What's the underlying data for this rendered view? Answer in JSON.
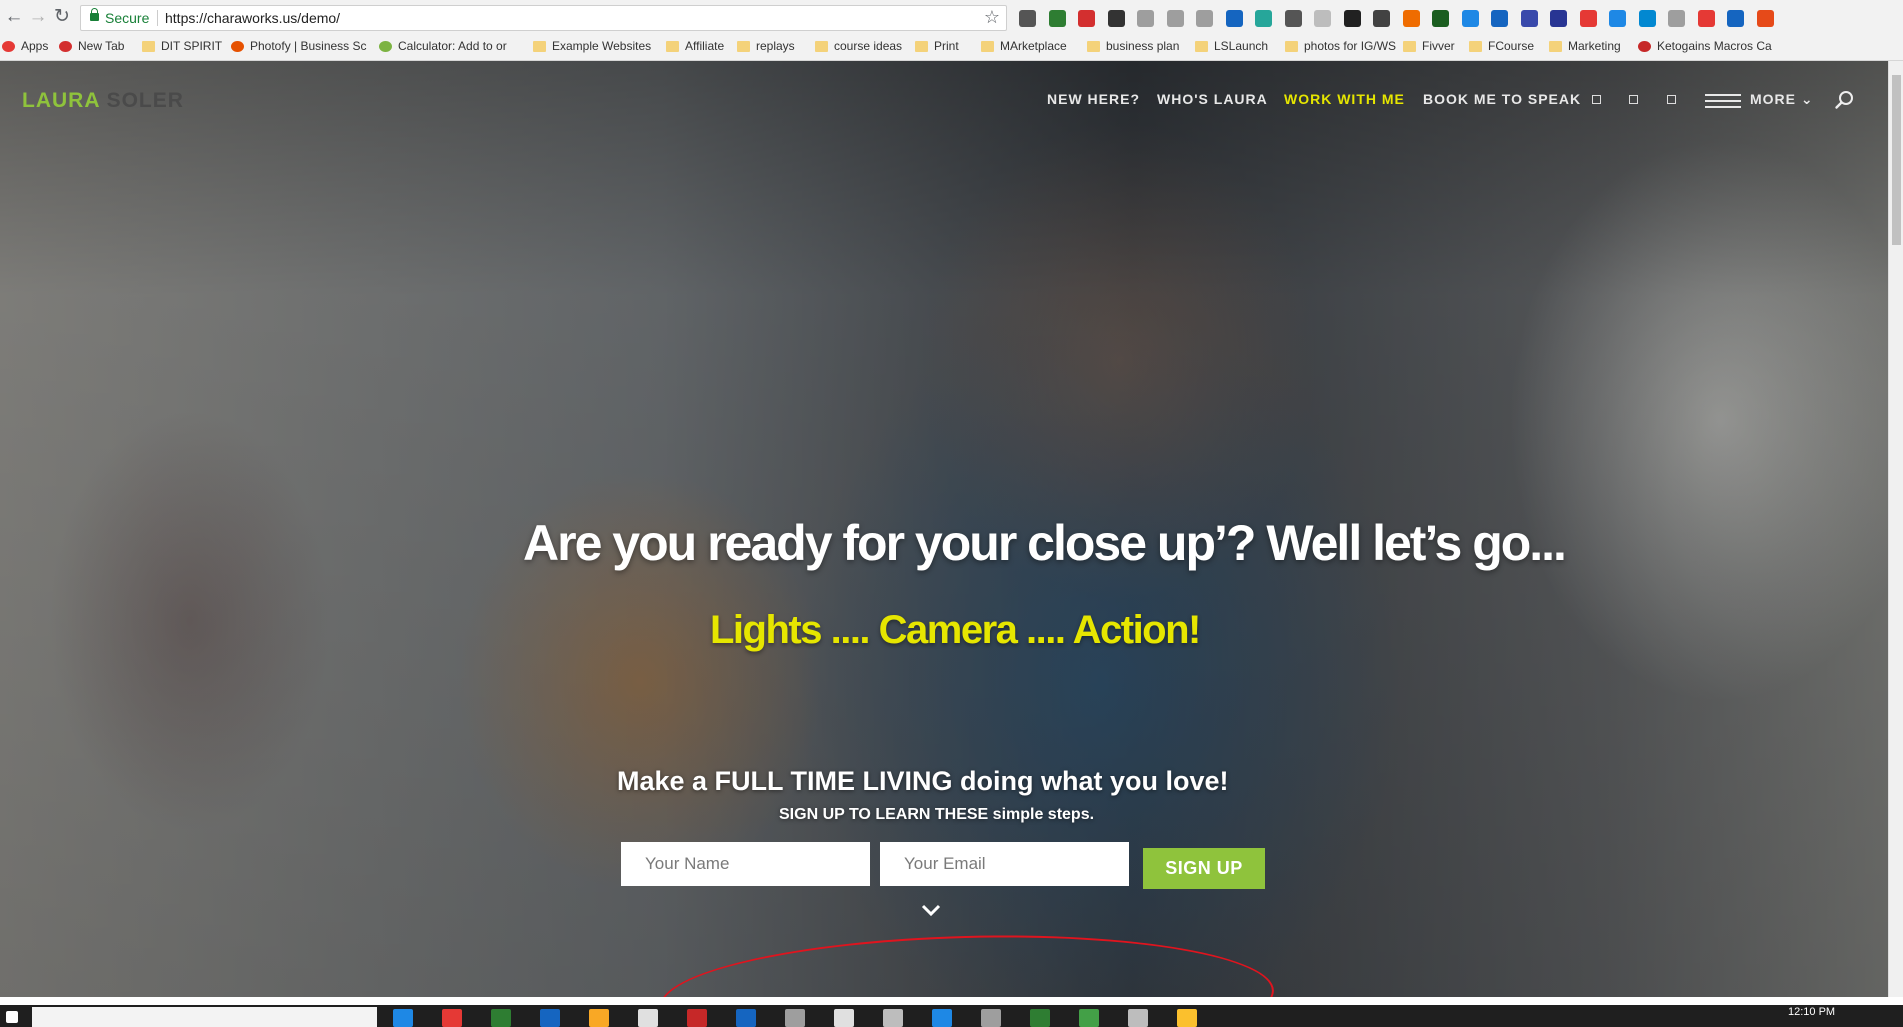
{
  "browser": {
    "secure_label": "Secure",
    "url": "https://charaworks.us/demo/",
    "bookmarks": [
      {
        "label": "Apps",
        "icon": "apps-grid-icon",
        "color": "#e53935"
      },
      {
        "label": "New Tab",
        "icon": "new-tab-icon",
        "color": "#d32f2f"
      },
      {
        "label": "DIT SPIRIT",
        "icon": "folder-icon",
        "color": "#f4d27a"
      },
      {
        "label": "Photofy | Business Sc",
        "icon": "photofy-icon",
        "color": "#e65100"
      },
      {
        "label": "Calculator: Add to or",
        "icon": "calculator-icon",
        "color": "#7cb342"
      },
      {
        "label": "Example Websites",
        "icon": "folder-icon",
        "color": "#f4d27a"
      },
      {
        "label": "Affiliate",
        "icon": "folder-icon",
        "color": "#f4d27a"
      },
      {
        "label": "replays",
        "icon": "folder-icon",
        "color": "#f4d27a"
      },
      {
        "label": "course ideas",
        "icon": "folder-icon",
        "color": "#f4d27a"
      },
      {
        "label": "Print",
        "icon": "folder-icon",
        "color": "#f4d27a"
      },
      {
        "label": "MArketplace",
        "icon": "folder-icon",
        "color": "#f4d27a"
      },
      {
        "label": "business plan",
        "icon": "folder-icon",
        "color": "#f4d27a"
      },
      {
        "label": "LSLaunch",
        "icon": "folder-icon",
        "color": "#f4d27a"
      },
      {
        "label": "photos for IG/WS",
        "icon": "folder-icon",
        "color": "#f4d27a"
      },
      {
        "label": "Fivver",
        "icon": "folder-icon",
        "color": "#f4d27a"
      },
      {
        "label": "FCourse",
        "icon": "folder-icon",
        "color": "#f4d27a"
      },
      {
        "label": "Marketing",
        "icon": "folder-icon",
        "color": "#f4d27a"
      },
      {
        "label": "Ketogains Macros Ca",
        "icon": "ketogains-icon",
        "color": "#c62828"
      }
    ],
    "extension_colors": [
      "#555555",
      "#2e7d32",
      "#d32f2f",
      "#333333",
      "#9e9e9e",
      "#9e9e9e",
      "#9e9e9e",
      "#1565c0",
      "#26a69a",
      "#555555",
      "#bdbdbd",
      "#212121",
      "#424242",
      "#ef6c00",
      "#1b5e20",
      "#1e88e5",
      "#1565c0",
      "#3949ab",
      "#283593",
      "#e53935",
      "#1e88e5",
      "#0288d1",
      "#9e9e9e",
      "#e53935",
      "#1565c0",
      "#e64a19"
    ]
  },
  "site": {
    "logo_first": "LAURA",
    "logo_last": "SOLER",
    "nav": [
      {
        "label": "NEW HERE?",
        "active": false
      },
      {
        "label": "WHO'S LAURA",
        "active": false
      },
      {
        "label": "WORK WITH ME",
        "active": true
      },
      {
        "label": "BOOK ME TO SPEAK",
        "active": false
      }
    ],
    "more_label": "MORE",
    "accent_green": "#8fc33c",
    "accent_yellow": "#e6e600"
  },
  "hero": {
    "headline": "Are you ready for your close up’? Well let’s go...",
    "subline": "Lights .... Camera .... Action!",
    "tagline": "Make a FULL TIME LIVING doing what you love!",
    "sub_tagline": "SIGN UP TO LEARN THESE simple steps.",
    "name_placeholder": "Your Name",
    "email_placeholder": "Your Email",
    "signup_label": "SIGN UP"
  },
  "taskbar": {
    "time": "12:10 PM"
  }
}
